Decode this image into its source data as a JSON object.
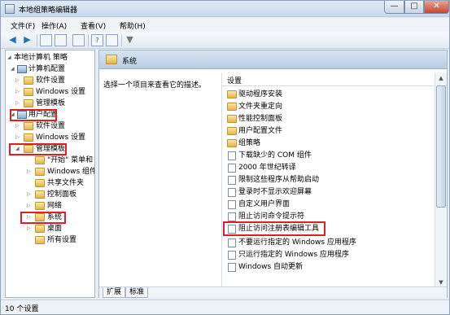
{
  "window": {
    "title": "本地组策略编辑器",
    "min": "—",
    "max": "□",
    "close": "✕"
  },
  "menu": [
    "文件(F)",
    "操作(A)",
    "查看(V)",
    "帮助(H)"
  ],
  "toolbar": {
    "icons": [
      "back-icon",
      "forward-icon",
      "up-icon",
      "show-tree-icon",
      "export-icon",
      "help-icon",
      "properties-icon",
      "filter-icon"
    ],
    "back": "◀",
    "forward": "▶",
    "help": "?",
    "filter": "▼"
  },
  "tree": {
    "items": [
      {
        "label": "本地计算机 策略",
        "icon": "pc-icon"
      },
      {
        "label": "计算机配置",
        "icon": "pc-icon"
      },
      {
        "label": "软件设置",
        "icon": "folder-icon"
      },
      {
        "label": "Windows 设置",
        "icon": "folder-icon"
      },
      {
        "label": "管理模板",
        "icon": "folder-icon"
      },
      {
        "label": "用户配置",
        "icon": "user-icon"
      },
      {
        "label": "软件设置",
        "icon": "folder-icon"
      },
      {
        "label": "Windows 设置",
        "icon": "folder-icon"
      },
      {
        "label": "管理模板",
        "icon": "folder-icon"
      },
      {
        "label": "\"开始\" 菜单和",
        "icon": "folder-icon"
      },
      {
        "label": "Windows 组件",
        "icon": "folder-icon"
      },
      {
        "label": "共享文件夹",
        "icon": "folder-icon"
      },
      {
        "label": "控制面板",
        "icon": "folder-icon"
      },
      {
        "label": "网络",
        "icon": "folder-icon"
      },
      {
        "label": "系统",
        "icon": "folder-icon"
      },
      {
        "label": "桌面",
        "icon": "folder-icon"
      },
      {
        "label": "所有设置",
        "icon": "folder-icon"
      }
    ]
  },
  "right": {
    "header": "系统",
    "description": "选择一个项目来查看它的描述。",
    "column": "设置",
    "rows": [
      {
        "label": "驱动程序安装",
        "icon": "folder"
      },
      {
        "label": "文件夹重定向",
        "icon": "folder"
      },
      {
        "label": "性能控制面板",
        "icon": "folder"
      },
      {
        "label": "用户配置文件",
        "icon": "folder"
      },
      {
        "label": "组策略",
        "icon": "folder"
      },
      {
        "label": "下载缺少的 COM 组件",
        "icon": "doc"
      },
      {
        "label": "2000 年世纪转译",
        "icon": "doc"
      },
      {
        "label": "限制这些程序从帮助启动",
        "icon": "doc"
      },
      {
        "label": "登录时不显示欢迎屏幕",
        "icon": "doc"
      },
      {
        "label": "自定义用户界面",
        "icon": "doc"
      },
      {
        "label": "阻止访问命令提示符",
        "icon": "doc"
      },
      {
        "label": "阻止访问注册表编辑工具",
        "icon": "doc"
      },
      {
        "label": "不要运行指定的 Windows 应用程序",
        "icon": "doc"
      },
      {
        "label": "只运行指定的 Windows 应用程序",
        "icon": "doc"
      },
      {
        "label": "Windows 自动更新",
        "icon": "doc"
      }
    ],
    "tabs": [
      "扩展",
      "标准"
    ]
  },
  "scroll": {
    "up": "▲",
    "down": "▼"
  },
  "status": "10 个设置",
  "colors": {
    "highlight_border": "#e02020",
    "header_bg": "#c9d9ec",
    "folder": "#e3b54c"
  }
}
